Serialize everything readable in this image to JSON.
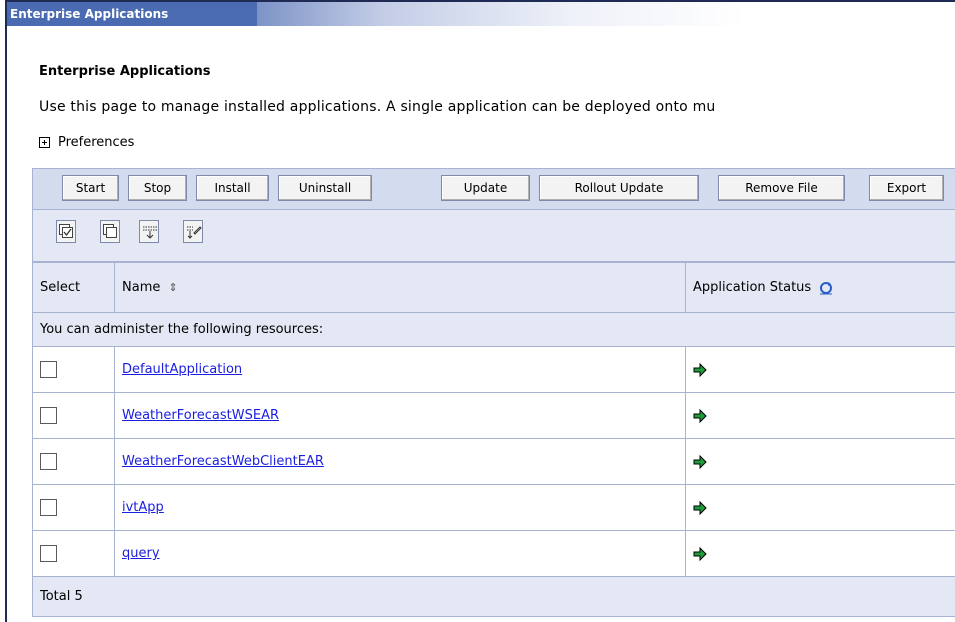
{
  "window": {
    "title": "Enterprise Applications"
  },
  "page": {
    "header": "Enterprise Applications",
    "description": "Use this page to manage installed applications. A single application can be deployed onto mu",
    "preferences_label": "Preferences"
  },
  "toolbar": {
    "buttons": [
      "Start",
      "Stop",
      "Install",
      "Uninstall",
      "Update",
      "Rollout Update",
      "Remove File",
      "Export"
    ]
  },
  "table": {
    "columns": {
      "select": "Select",
      "name": "Name",
      "status": "Application Status"
    },
    "info_text": "You can administer the following resources:",
    "rows": [
      {
        "name": "DefaultApplication",
        "status_icon": "running-arrow-icon",
        "selected": false
      },
      {
        "name": "WeatherForecastWSEAR",
        "status_icon": "running-arrow-icon",
        "selected": false
      },
      {
        "name": "WeatherForecastWebClientEAR",
        "status_icon": "running-arrow-icon",
        "selected": false
      },
      {
        "name": "ivtApp",
        "status_icon": "running-arrow-icon",
        "selected": false
      },
      {
        "name": "query",
        "status_icon": "running-arrow-icon",
        "selected": false
      }
    ],
    "total_text": "Total 5"
  },
  "colors": {
    "title_bar": "#4a6bb1",
    "toolbar_bg": "#d3dbee",
    "table_header_bg": "#e3e8f4",
    "link": "#1a1ee0",
    "status_running": "#1e9b3b"
  }
}
